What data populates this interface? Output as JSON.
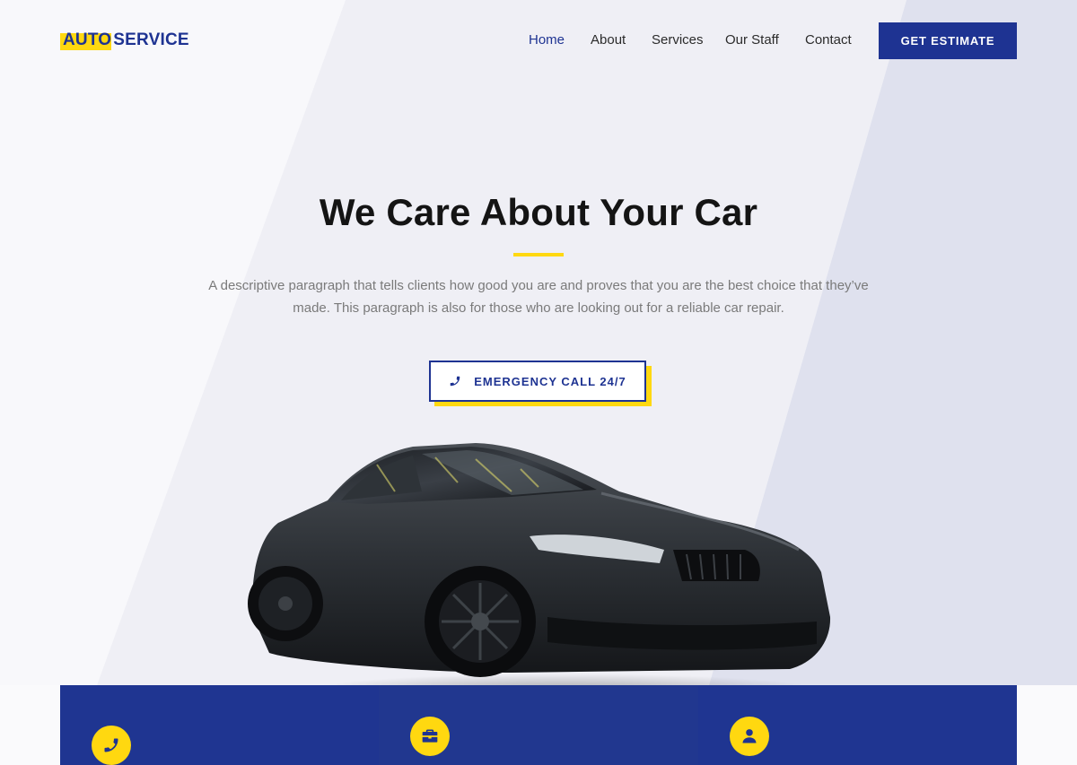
{
  "logo": {
    "part1": "AUTO",
    "part2": "SERVICE"
  },
  "nav": {
    "items": [
      {
        "label": "Home",
        "active": true
      },
      {
        "label": "About",
        "active": false
      },
      {
        "label": "Services",
        "active": false
      },
      {
        "label": "Our Staff",
        "active": false
      },
      {
        "label": "Contact",
        "active": false
      }
    ]
  },
  "header": {
    "cta_label": "GET ESTIMATE"
  },
  "hero": {
    "title": "We Care About Your Car",
    "description": "A descriptive paragraph that tells clients how good you are and proves that you are the best choice that they’ve made. This paragraph is also for those who are looking out for a reliable car repair.",
    "button_label": "EMERGENCY CALL 24/7",
    "button_icon": "phone-icon"
  },
  "features": {
    "icons": [
      "phone-icon",
      "briefcase-icon",
      "user-icon"
    ]
  },
  "colors": {
    "brand_blue": "#1e3392",
    "accent_yellow": "#ffd810",
    "text_dark": "#141414",
    "text_muted": "#7a7a7a",
    "panel_light": "#f4f4f9",
    "panel_mid": "#dfe1ee"
  }
}
